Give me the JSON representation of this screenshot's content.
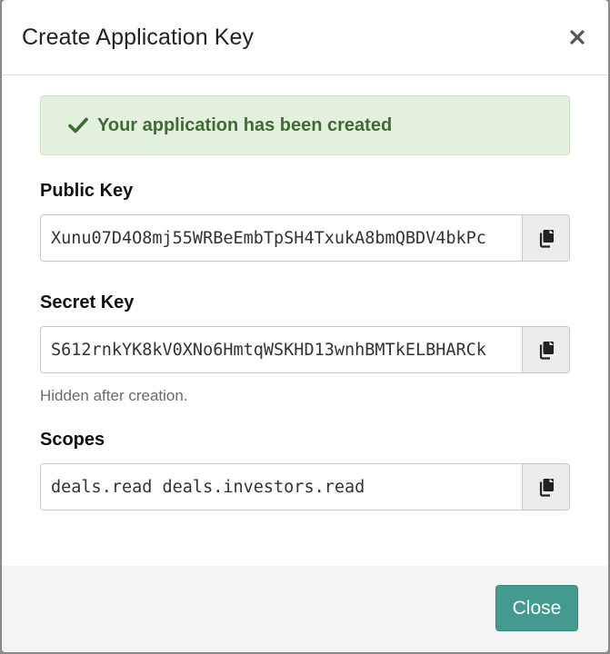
{
  "modal": {
    "title": "Create Application Key"
  },
  "alert": {
    "message": "Your application has been created",
    "color": "#3f6b35"
  },
  "public_key": {
    "label": "Public Key",
    "value": "Xunu07D4O8mj55WRBeEmbTpSH4TxukA8bmQBDV4bkPc"
  },
  "secret_key": {
    "label": "Secret Key",
    "value": "S612rnkYK8kV0XNo6HmtqWSKHD13wnhBMTkELBHARCk",
    "help": "Hidden after creation."
  },
  "scopes": {
    "label": "Scopes",
    "value": "deals.read deals.investors.read"
  },
  "footer": {
    "close_label": "Close",
    "accent": "#459a8f"
  },
  "icons": {
    "close": "close-icon",
    "check": "check-icon",
    "copy": "copy-icon"
  }
}
